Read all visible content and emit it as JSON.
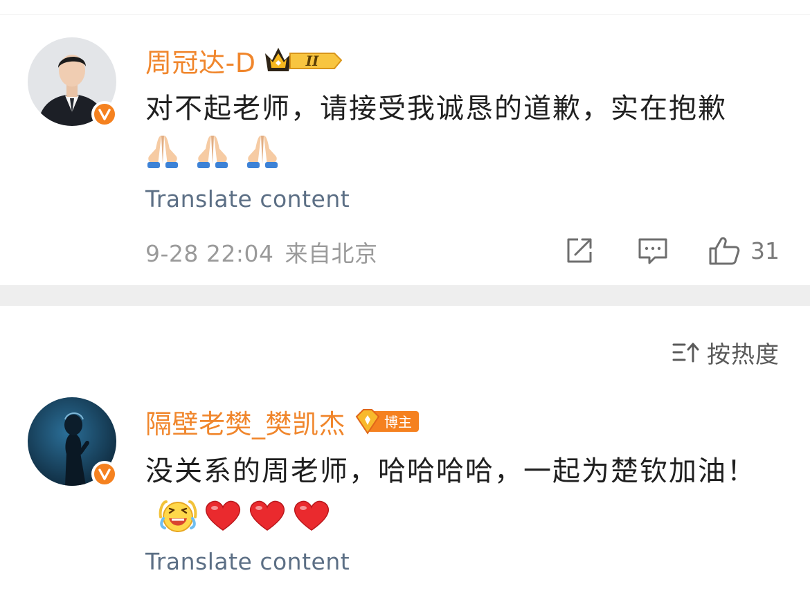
{
  "comments": [
    {
      "username": "周冠达-D",
      "badge_level": "II",
      "text": "对不起老师，请接受我诚恳的道歉，实在抱歉",
      "emojis": [
        "folded-hands",
        "folded-hands",
        "folded-hands"
      ],
      "translate": "Translate content",
      "timestamp": "9-28 22:04",
      "location": "来自北京",
      "like_count": "31"
    },
    {
      "username": "隔壁老樊_樊凯杰",
      "badge_label": "博主",
      "text": "没关系的周老师，哈哈哈哈，一起为楚钦加油！",
      "emojis": [
        "laughing-face",
        "red-heart",
        "red-heart",
        "red-heart"
      ],
      "translate": "Translate content"
    }
  ],
  "sort": {
    "label": "按热度"
  },
  "colors": {
    "username": "#f0862c",
    "verified": "#f5811f",
    "translate": "#5c6f85",
    "meta": "#9a9a9a",
    "separator": "#eeeeee"
  }
}
